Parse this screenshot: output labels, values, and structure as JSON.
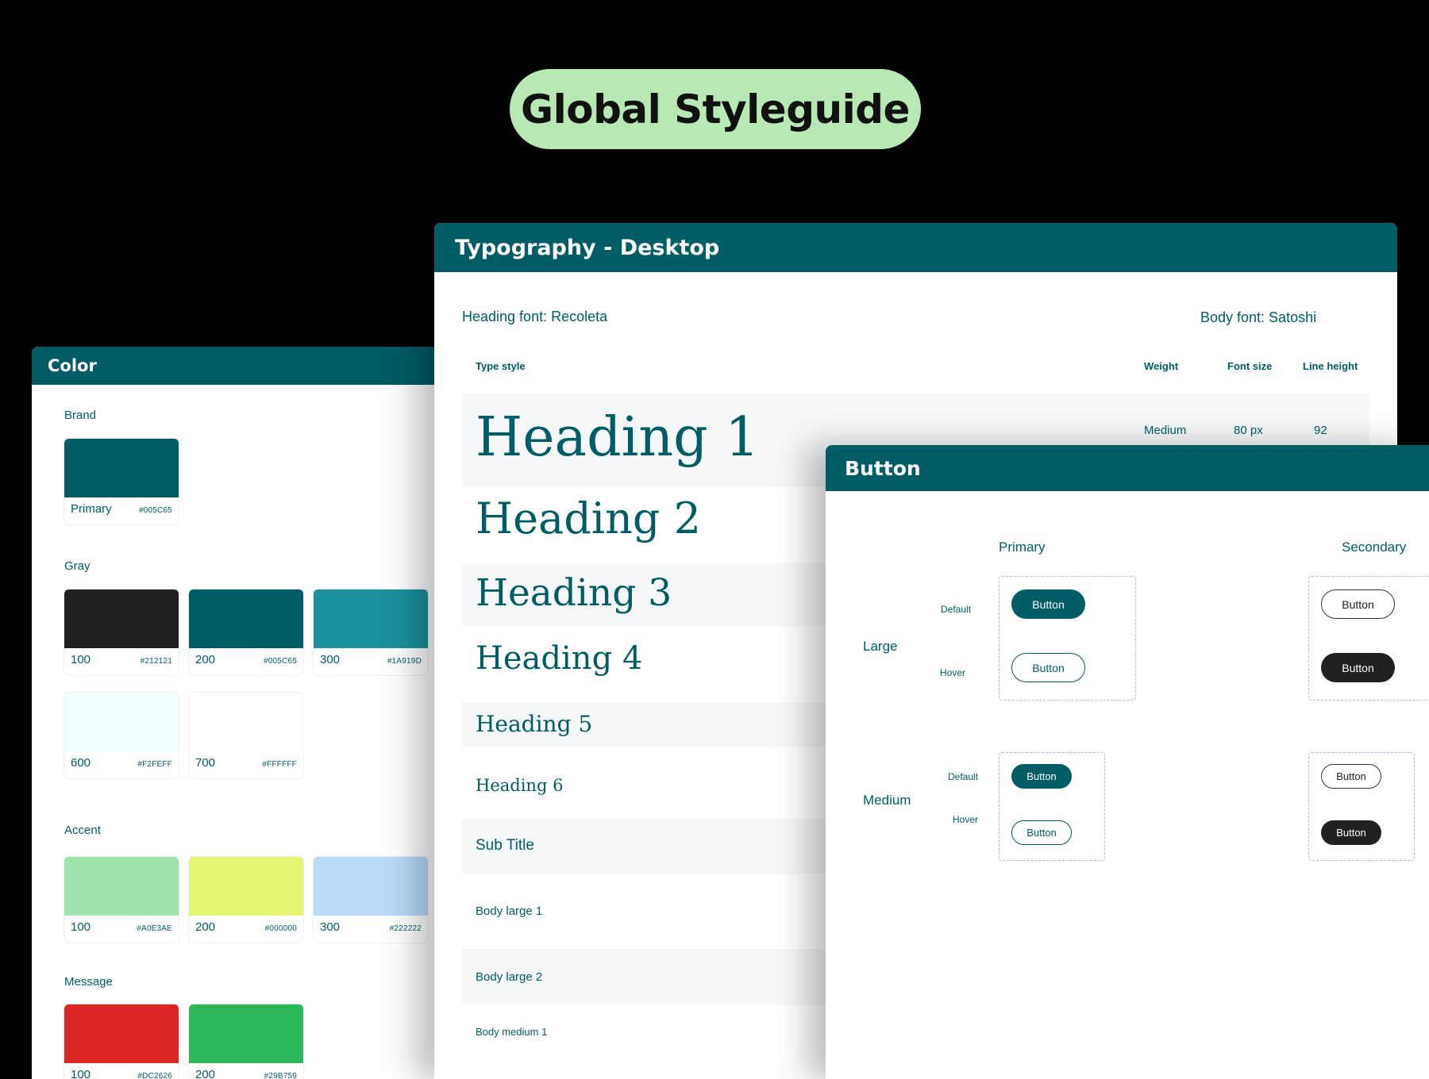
{
  "title": "Global Styleguide",
  "color_panel": {
    "header": "Color",
    "brand": {
      "label": "Brand",
      "swatches": [
        {
          "name": "Primary",
          "hex": "#005C65",
          "color": "#005C65"
        }
      ]
    },
    "gray": {
      "label": "Gray",
      "swatches": [
        {
          "name": "100",
          "hex": "#212121",
          "color": "#212121"
        },
        {
          "name": "200",
          "hex": "#005C65",
          "color": "#005C65"
        },
        {
          "name": "300",
          "hex": "#1A919D",
          "color": "#1A919D"
        },
        {
          "name": "600",
          "hex": "#F2FEFF",
          "color": "#F2FEFF"
        },
        {
          "name": "700",
          "hex": "#FFFFFF",
          "color": "#FFFFFF"
        }
      ]
    },
    "accent": {
      "label": "Accent",
      "swatches": [
        {
          "name": "100",
          "hex": "#A0E3AE",
          "color": "#A0E3AE"
        },
        {
          "name": "200",
          "hex": "#000000",
          "color": "#E6F474"
        },
        {
          "name": "300",
          "hex": "#222222",
          "color": "#B9DAF9"
        }
      ]
    },
    "message": {
      "label": "Message",
      "swatches": [
        {
          "name": "100",
          "hex": "#DC2626",
          "color": "#DC2626"
        },
        {
          "name": "200",
          "hex": "#29B759",
          "color": "#2EB85C"
        }
      ]
    }
  },
  "typography_panel": {
    "header": "Typography - Desktop",
    "heading_font": "Heading font: Recoleta",
    "body_font": "Body font: Satoshi",
    "columns": {
      "type_style": "Type style",
      "weight": "Weight",
      "font_size": "Font size",
      "line_height": "Line height"
    },
    "rows": [
      {
        "label": "Heading 1",
        "weight": "Medium",
        "font_size": "80 px",
        "line_height": "92"
      },
      {
        "label": "Heading 2"
      },
      {
        "label": "Heading 3"
      },
      {
        "label": "Heading 4"
      },
      {
        "label": "Heading 5"
      },
      {
        "label": "Heading 6"
      },
      {
        "label": "Sub Title"
      },
      {
        "label": "Body large 1"
      },
      {
        "label": "Body large 2"
      },
      {
        "label": "Body medium 1"
      }
    ]
  },
  "button_panel": {
    "header": "Button",
    "primary_label": "Primary",
    "secondary_label": "Secondary",
    "large_label": "Large",
    "medium_label": "Medium",
    "default_label": "Default",
    "hover_label": "Hover",
    "button_text": "Button"
  }
}
